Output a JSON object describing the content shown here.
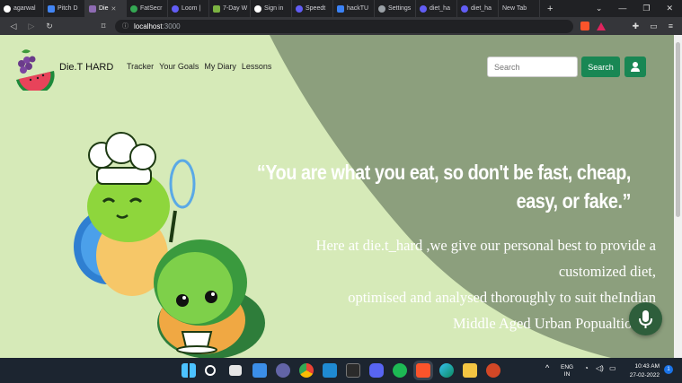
{
  "browser": {
    "tabs": [
      {
        "label": "agarwal",
        "color": "#ffffff"
      },
      {
        "label": "Pitch D",
        "color": "#4285f4"
      },
      {
        "label": "Die",
        "color": "#8e6bb3",
        "active": true
      },
      {
        "label": "FatSecr",
        "color": "#34a853"
      },
      {
        "label": "Loom |",
        "color": "#625df5"
      },
      {
        "label": "7-Day W",
        "color": "#7cb342"
      },
      {
        "label": "Sign in",
        "color": "#ea4335"
      },
      {
        "label": "Speedt",
        "color": "#625df5"
      },
      {
        "label": "hackTU",
        "color": "#3b82f6"
      },
      {
        "label": "Settings",
        "color": "#9aa0a6"
      },
      {
        "label": "diet_ha",
        "color": "#625df5"
      },
      {
        "label": "diet_ha",
        "color": "#625df5"
      },
      {
        "label": "New Tab",
        "color": "#35363a"
      }
    ],
    "url_host": "localhost",
    "url_port": ":3000"
  },
  "site": {
    "brand": "Die.T HARD",
    "nav": [
      "Tracker",
      "Your Goals",
      "My Diary",
      "Lessons"
    ],
    "search_placeholder": "Search",
    "search_button": "Search",
    "quote_line1": "“You are what you eat, so don't be fast, cheap,",
    "quote_line2": "easy, or fake.”",
    "desc_lines": [
      "Here at die.t_hard ,we give our personal best to provide a",
      "customized diet,",
      "optimised and analysed thoroughly to suit theIndian",
      "Middle Aged Urban Popualtion"
    ],
    "colors": {
      "hero_bg": "#8c9f7d",
      "hero_curve": "#d6eab8",
      "accent": "#198754"
    }
  },
  "taskbar": {
    "lang_line1": "ENG",
    "lang_line2": "IN",
    "time": "10:43 AM",
    "date": "27-02-2022",
    "notif_count": "1"
  }
}
